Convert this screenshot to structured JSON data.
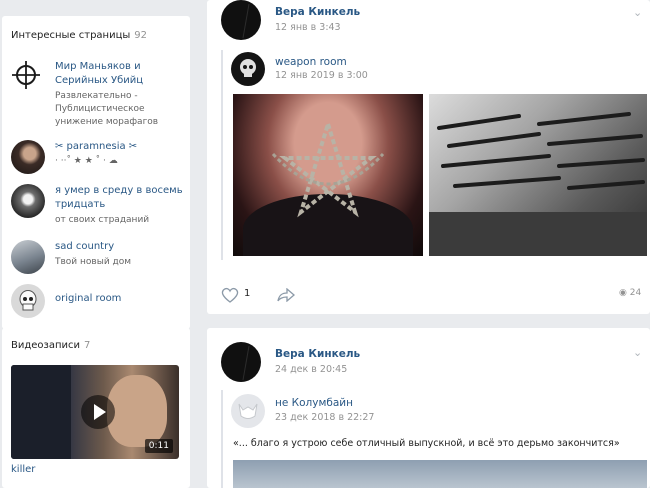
{
  "pages": {
    "heading": "Интересные страницы",
    "count": "92",
    "items": [
      {
        "name": "Мир Маньяков и Серийных Убийц",
        "desc": "Развлекательно - Публицистическое унижение морафагов"
      },
      {
        "name": "✂ paramnesia ✂",
        "desc": "· ·‧˚ ★ ★ ˚ · ☁"
      },
      {
        "name": "я умер в среду в восемь тридцать",
        "desc": "от своих страданий"
      },
      {
        "name": "sad country",
        "desc": "Твой новый дом"
      },
      {
        "name": "original room",
        "desc": ""
      }
    ]
  },
  "videos": {
    "heading": "Видеозаписи",
    "count": "7",
    "duration": "0:11",
    "title": "killer"
  },
  "posts": [
    {
      "author": "Вера Кинкель",
      "time": "12 янв в 3:43",
      "repost_author": "weapon room",
      "repost_time": "12 янв 2019 в 3:00",
      "likes": "1",
      "views": "24"
    },
    {
      "author": "Вера Кинкель",
      "time": "24 дек в 20:45",
      "repost_author": "не Колумбайн",
      "repost_time": "23 дек 2018 в 22:27",
      "text": "«... благо я устрою себе отличный выпускной, и всё это дерьмо закончится»"
    }
  ]
}
